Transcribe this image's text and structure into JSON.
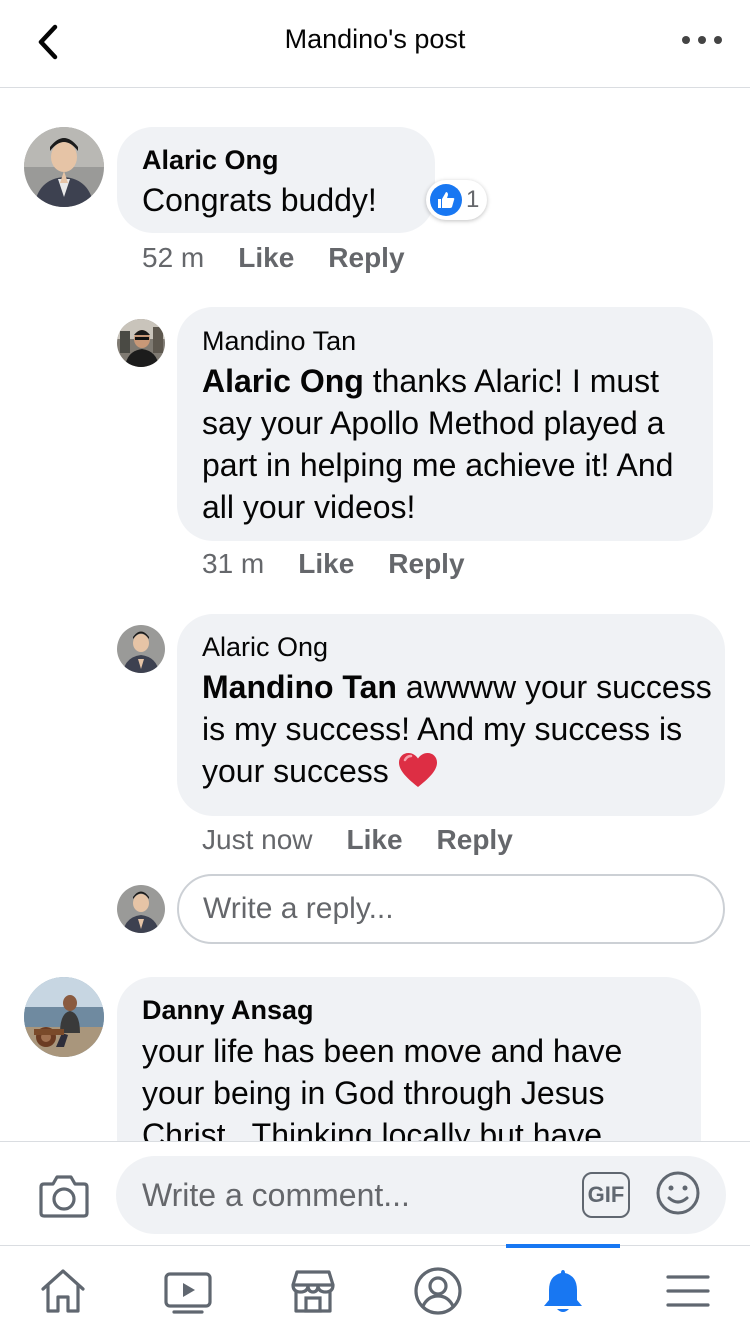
{
  "header": {
    "title": "Mandino's post"
  },
  "comments": [
    {
      "author": "Alaric Ong",
      "text": "Congrats buddy!",
      "reaction_count": "1",
      "time": "52 m",
      "like_label": "Like",
      "reply_label": "Reply",
      "replies": [
        {
          "author": "Mandino Tan",
          "mention": "Alaric Ong",
          "text": " thanks Alaric! I must say your Apollo Method played a part in helping me achieve it! And all your videos!",
          "time": "31 m",
          "like_label": "Like",
          "reply_label": "Reply"
        },
        {
          "author": "Alaric Ong",
          "mention": "Mandino Tan",
          "text": " awwww your success is my success! And my success is your success",
          "emoji": "❤️",
          "time": "Just now",
          "like_label": "Like",
          "reply_label": "Reply"
        }
      ],
      "reply_placeholder": "Write a reply..."
    },
    {
      "author": "Danny Ansag",
      "text": "your life has been move and have your being in God through Jesus Christ . Thinking locally but have"
    }
  ],
  "composer": {
    "placeholder": "Write a comment...",
    "gif_label": "GIF"
  },
  "tabs": [
    {
      "name": "home-icon"
    },
    {
      "name": "watch-icon"
    },
    {
      "name": "marketplace-icon"
    },
    {
      "name": "profile-icon"
    },
    {
      "name": "notifications-icon",
      "active": true
    },
    {
      "name": "menu-icon"
    }
  ],
  "colors": {
    "accent": "#1877f2",
    "bubble": "#f0f2f5",
    "secondary_text": "#65676b",
    "heart": "#e0245e"
  }
}
